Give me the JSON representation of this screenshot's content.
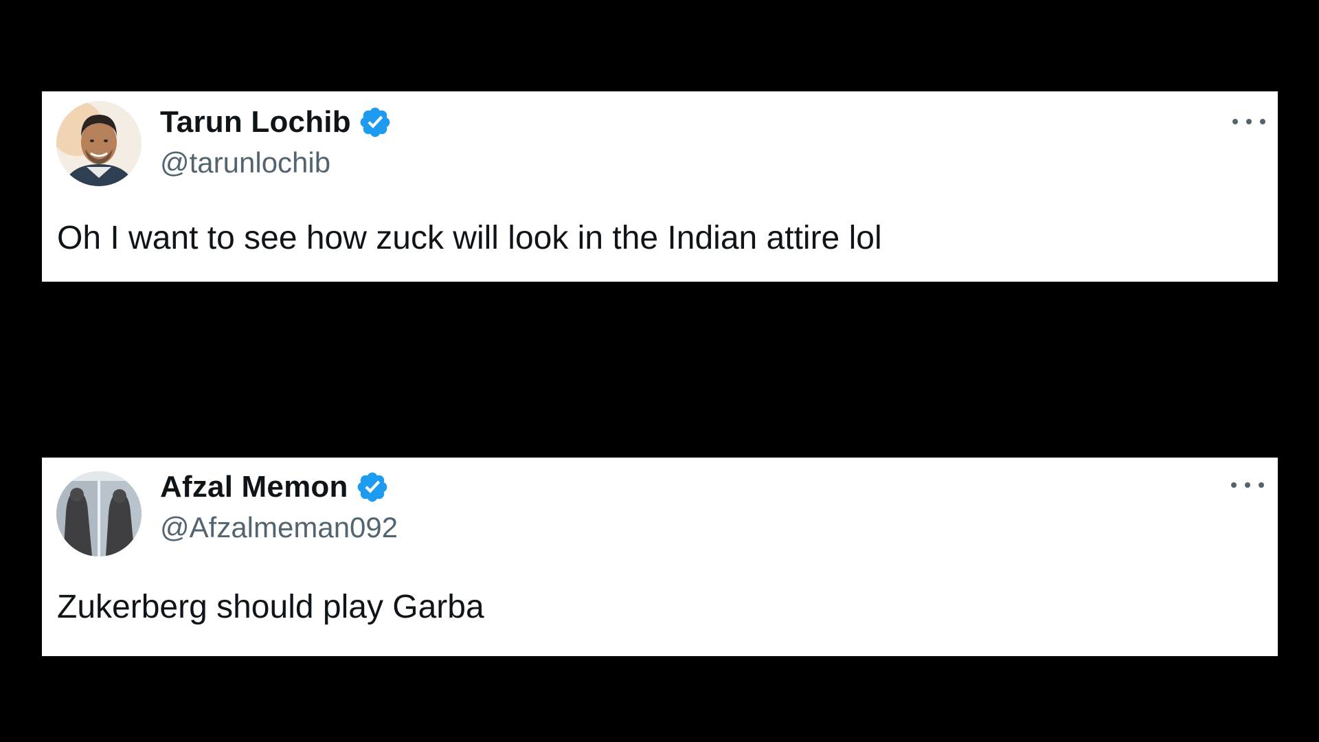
{
  "tweets": [
    {
      "display_name": "Tarun Lochib",
      "handle": "@tarunlochib",
      "verified": true,
      "avatar_icon": "profile-photo-man-icon",
      "more_icon": "more-options-icon",
      "text": "Oh I want to see how zuck will look in the Indian attire lol"
    },
    {
      "display_name": "Afzal Memon",
      "handle": "@Afzalmeman092",
      "verified": true,
      "avatar_icon": "profile-photo-statue-icon",
      "more_icon": "more-options-icon",
      "text": "Zukerberg should play Garba"
    }
  ],
  "colors": {
    "background": "#000000",
    "card": "#ffffff",
    "name": "#0f1419",
    "handle": "#536471",
    "verified_badge": "#1d9bf0"
  }
}
